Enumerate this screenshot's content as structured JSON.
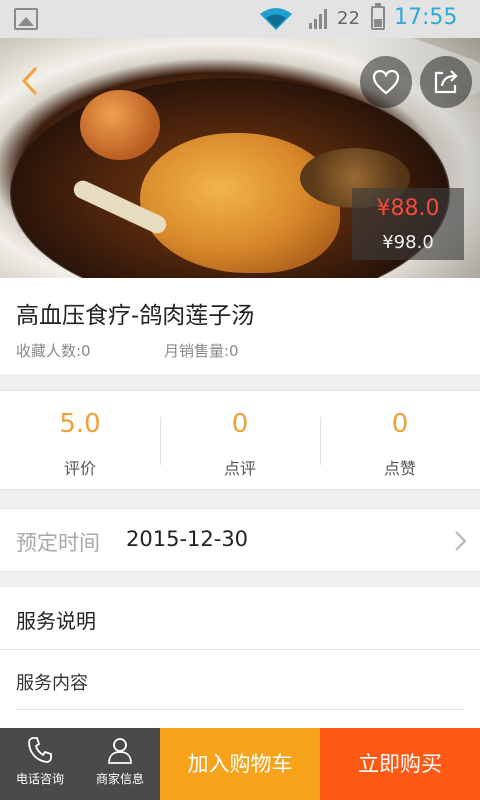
{
  "status_bar": {
    "signal_number": "22",
    "time": "17:55"
  },
  "hero": {
    "icons": {
      "back": "chevron-left-icon",
      "favorite": "heart-icon",
      "share": "share-icon"
    },
    "price_current": "¥88.0",
    "price_original": "¥98.0"
  },
  "product": {
    "title": "高血压食疗-鸽肉莲子汤",
    "favorites_label": "收藏人数:0",
    "monthly_sales_label": "月销售量:0"
  },
  "stats": [
    {
      "value": "5.0",
      "label": "评价"
    },
    {
      "value": "0",
      "label": "点评"
    },
    {
      "value": "0",
      "label": "点赞"
    }
  ],
  "booking": {
    "label": "预定时间",
    "date": "2015-12-30"
  },
  "service": {
    "title": "服务说明",
    "content_label": "服务内容"
  },
  "bottom_bar": {
    "phone_label": "电话咨询",
    "merchant_label": "商家信息",
    "add_to_cart": "加入购物车",
    "buy_now": "立即购买"
  },
  "colors": {
    "accent_orange": "#f7a21b",
    "buy_orange": "#ff5a14",
    "price_red": "#f04b3c",
    "stat_orange": "#f0a038",
    "time_blue": "#2fa9d8"
  }
}
